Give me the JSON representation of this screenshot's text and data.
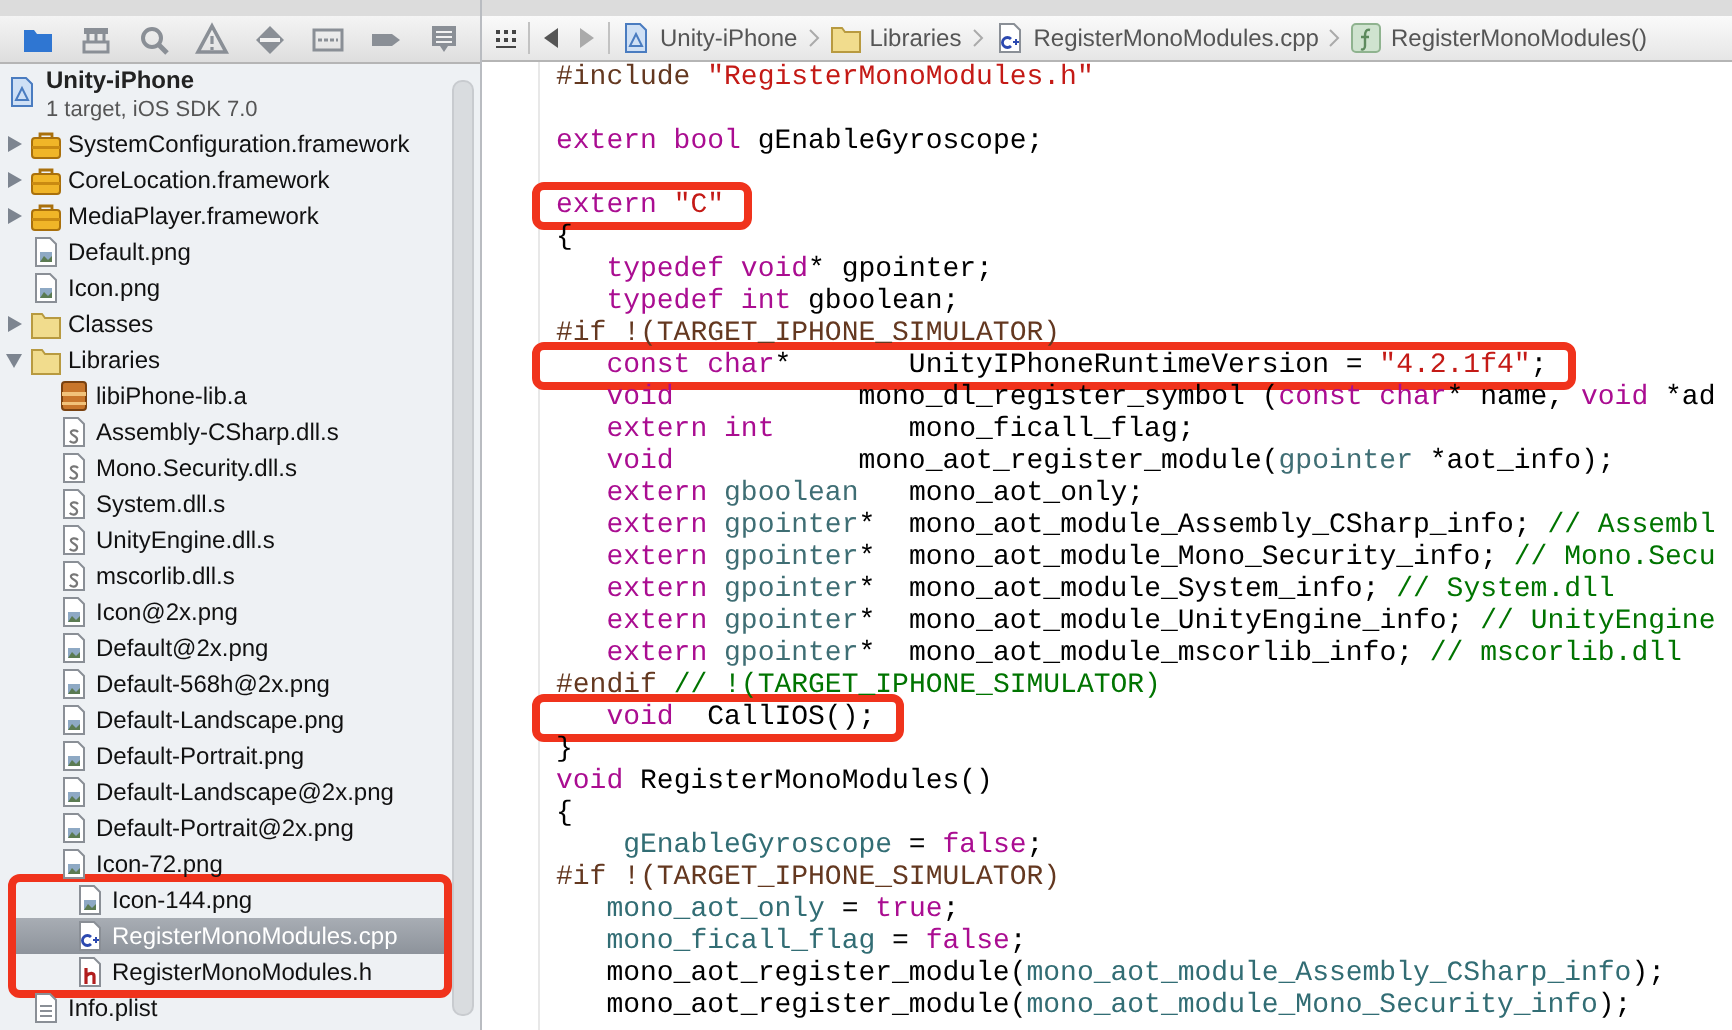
{
  "navigator": {
    "toolbar": [
      {
        "kind": "project",
        "selected": true
      },
      {
        "kind": "symbols",
        "selected": false
      },
      {
        "kind": "search",
        "selected": false
      },
      {
        "kind": "issues",
        "selected": false
      },
      {
        "kind": "tests",
        "selected": false
      },
      {
        "kind": "debug",
        "selected": false
      },
      {
        "kind": "breakpoints",
        "selected": false
      },
      {
        "kind": "log",
        "selected": false
      }
    ],
    "project": {
      "name": "Unity-iPhone",
      "subtitle": "1 target, iOS SDK 7.0"
    },
    "items": [
      {
        "label": "SystemConfiguration.framework",
        "kind": "framework",
        "expanded": false,
        "selected": false,
        "highlighted": false
      },
      {
        "label": "CoreLocation.framework",
        "kind": "framework",
        "expanded": false,
        "selected": false,
        "highlighted": false
      },
      {
        "label": "MediaPlayer.framework",
        "kind": "framework",
        "expanded": false,
        "selected": false,
        "highlighted": false
      },
      {
        "label": "Default.png",
        "kind": "image",
        "selected": false,
        "highlighted": false
      },
      {
        "label": "Icon.png",
        "kind": "image",
        "selected": false,
        "highlighted": false
      },
      {
        "label": "Classes",
        "kind": "folder",
        "expanded": false,
        "selected": false,
        "highlighted": false
      },
      {
        "label": "Libraries",
        "kind": "folder",
        "expanded": true,
        "selected": false,
        "highlighted": false,
        "children": [
          {
            "label": "libiPhone-lib.a",
            "kind": "library",
            "selected": false,
            "highlighted": false
          },
          {
            "label": "Assembly-CSharp.dll.s",
            "kind": "assembly",
            "selected": false,
            "highlighted": false
          },
          {
            "label": "Mono.Security.dll.s",
            "kind": "assembly",
            "selected": false,
            "highlighted": false
          },
          {
            "label": "System.dll.s",
            "kind": "assembly",
            "selected": false,
            "highlighted": false
          },
          {
            "label": "UnityEngine.dll.s",
            "kind": "assembly",
            "selected": false,
            "highlighted": false
          },
          {
            "label": "mscorlib.dll.s",
            "kind": "assembly",
            "selected": false,
            "highlighted": false
          },
          {
            "label": "Icon@2x.png",
            "kind": "image",
            "selected": false,
            "highlighted": false
          },
          {
            "label": "Default@2x.png",
            "kind": "image",
            "selected": false,
            "highlighted": false
          },
          {
            "label": "Default-568h@2x.png",
            "kind": "image",
            "selected": false,
            "highlighted": false
          },
          {
            "label": "Default-Landscape.png",
            "kind": "image",
            "selected": false,
            "highlighted": false
          },
          {
            "label": "Default-Portrait.png",
            "kind": "image",
            "selected": false,
            "highlighted": false
          },
          {
            "label": "Default-Landscape@2x.png",
            "kind": "image",
            "selected": false,
            "highlighted": false
          },
          {
            "label": "Default-Portrait@2x.png",
            "kind": "image",
            "selected": false,
            "highlighted": false
          },
          {
            "label": "Icon-72.png",
            "kind": "image",
            "selected": false,
            "highlighted": false
          },
          {
            "label": "Icon-144.png",
            "kind": "image",
            "selected": false,
            "highlighted": true
          },
          {
            "label": "RegisterMonoModules.cpp",
            "kind": "cpp",
            "selected": true,
            "highlighted": true
          },
          {
            "label": "RegisterMonoModules.h",
            "kind": "header",
            "selected": false,
            "highlighted": true
          }
        ]
      },
      {
        "label": "Info.plist",
        "kind": "plist",
        "selected": false,
        "highlighted": false
      }
    ]
  },
  "jump_bar": [
    {
      "label": "Unity-iPhone",
      "kind": "project"
    },
    {
      "label": "Libraries",
      "kind": "folder"
    },
    {
      "label": "RegisterMonoModules.cpp",
      "kind": "cpp"
    },
    {
      "label": "RegisterMonoModules()",
      "kind": "function"
    }
  ],
  "code": {
    "lines": [
      {
        "kind": "code",
        "highlighted": false,
        "tokens": [
          {
            "kind": "preproc",
            "text": "#include "
          },
          {
            "kind": "string",
            "text": "\"RegisterMonoModules.h\""
          }
        ]
      },
      {
        "kind": "blank"
      },
      {
        "kind": "code",
        "highlighted": false,
        "tokens": [
          {
            "kind": "keyword",
            "text": "extern bool"
          },
          {
            "kind": "plain",
            "text": " gEnableGyroscope;"
          }
        ]
      },
      {
        "kind": "blank"
      },
      {
        "kind": "code",
        "highlighted": true,
        "tokens": [
          {
            "kind": "keyword",
            "text": "extern "
          },
          {
            "kind": "string",
            "text": "\"C\""
          }
        ]
      },
      {
        "kind": "code",
        "highlighted": false,
        "tokens": [
          {
            "kind": "plain",
            "text": "{"
          }
        ]
      },
      {
        "kind": "code",
        "highlighted": false,
        "tokens": [
          {
            "kind": "keyword",
            "text": "   typedef void"
          },
          {
            "kind": "plain",
            "text": "* gpointer;"
          }
        ]
      },
      {
        "kind": "code",
        "highlighted": false,
        "tokens": [
          {
            "kind": "keyword",
            "text": "   typedef int"
          },
          {
            "kind": "plain",
            "text": " gboolean;"
          }
        ]
      },
      {
        "kind": "code",
        "highlighted": false,
        "tokens": [
          {
            "kind": "preproc",
            "text": "#if !(TARGET_IPHONE_SIMULATOR)"
          }
        ]
      },
      {
        "kind": "code",
        "highlighted": true,
        "tokens": [
          {
            "kind": "keyword",
            "text": "   const char"
          },
          {
            "kind": "plain",
            "text": "*       UnityIPhoneRuntimeVersion = "
          },
          {
            "kind": "string",
            "text": "\"4.2.1f4\""
          },
          {
            "kind": "plain",
            "text": ";"
          }
        ]
      },
      {
        "kind": "code",
        "highlighted": false,
        "tokens": [
          {
            "kind": "keyword",
            "text": "   void"
          },
          {
            "kind": "plain",
            "text": "           mono_dl_register_symbol ("
          },
          {
            "kind": "keyword",
            "text": "const char"
          },
          {
            "kind": "plain",
            "text": "* name, "
          },
          {
            "kind": "keyword",
            "text": "void"
          },
          {
            "kind": "plain",
            "text": " *ad"
          }
        ]
      },
      {
        "kind": "code",
        "highlighted": false,
        "tokens": [
          {
            "kind": "keyword",
            "text": "   extern int"
          },
          {
            "kind": "plain",
            "text": "        mono_ficall_flag;"
          }
        ]
      },
      {
        "kind": "code",
        "highlighted": false,
        "tokens": [
          {
            "kind": "keyword",
            "text": "   void"
          },
          {
            "kind": "plain",
            "text": "           mono_aot_register_module("
          },
          {
            "kind": "type",
            "text": "gpointer"
          },
          {
            "kind": "plain",
            "text": " *aot_info);"
          }
        ]
      },
      {
        "kind": "code",
        "highlighted": false,
        "tokens": [
          {
            "kind": "keyword",
            "text": "   extern"
          },
          {
            "kind": "type",
            "text": " gboolean"
          },
          {
            "kind": "plain",
            "text": "   mono_aot_only;"
          }
        ]
      },
      {
        "kind": "code",
        "highlighted": false,
        "tokens": [
          {
            "kind": "keyword",
            "text": "   extern"
          },
          {
            "kind": "type",
            "text": " gpointer"
          },
          {
            "kind": "plain",
            "text": "*  mono_aot_module_Assembly_CSharp_info; "
          },
          {
            "kind": "comment",
            "text": "// Assembl"
          }
        ]
      },
      {
        "kind": "code",
        "highlighted": false,
        "tokens": [
          {
            "kind": "keyword",
            "text": "   extern"
          },
          {
            "kind": "type",
            "text": " gpointer"
          },
          {
            "kind": "plain",
            "text": "*  mono_aot_module_Mono_Security_info; "
          },
          {
            "kind": "comment",
            "text": "// Mono.Secu"
          }
        ]
      },
      {
        "kind": "code",
        "highlighted": false,
        "tokens": [
          {
            "kind": "keyword",
            "text": "   extern"
          },
          {
            "kind": "type",
            "text": " gpointer"
          },
          {
            "kind": "plain",
            "text": "*  mono_aot_module_System_info; "
          },
          {
            "kind": "comment",
            "text": "// System.dll"
          }
        ]
      },
      {
        "kind": "code",
        "highlighted": false,
        "tokens": [
          {
            "kind": "keyword",
            "text": "   extern"
          },
          {
            "kind": "type",
            "text": " gpointer"
          },
          {
            "kind": "plain",
            "text": "*  mono_aot_module_UnityEngine_info; "
          },
          {
            "kind": "comment",
            "text": "// UnityEngine"
          }
        ]
      },
      {
        "kind": "code",
        "highlighted": false,
        "tokens": [
          {
            "kind": "keyword",
            "text": "   extern"
          },
          {
            "kind": "type",
            "text": " gpointer"
          },
          {
            "kind": "plain",
            "text": "*  mono_aot_module_mscorlib_info; "
          },
          {
            "kind": "comment",
            "text": "// mscorlib.dll"
          }
        ]
      },
      {
        "kind": "code",
        "highlighted": false,
        "tokens": [
          {
            "kind": "preproc",
            "text": "#endif"
          },
          {
            "kind": "comment",
            "text": " // !(TARGET_IPHONE_SIMULATOR)"
          }
        ]
      },
      {
        "kind": "code",
        "highlighted": true,
        "tokens": [
          {
            "kind": "keyword",
            "text": "   void"
          },
          {
            "kind": "plain",
            "text": "  CallIOS();"
          }
        ]
      },
      {
        "kind": "code",
        "highlighted": false,
        "tokens": [
          {
            "kind": "plain",
            "text": "}"
          }
        ]
      },
      {
        "kind": "code",
        "highlighted": false,
        "tokens": [
          {
            "kind": "keyword",
            "text": "void"
          },
          {
            "kind": "plain",
            "text": " RegisterMonoModules()"
          }
        ]
      },
      {
        "kind": "code",
        "highlighted": false,
        "tokens": [
          {
            "kind": "plain",
            "text": "{"
          }
        ]
      },
      {
        "kind": "code",
        "highlighted": false,
        "tokens": [
          {
            "kind": "ident",
            "text": "    gEnableGyroscope"
          },
          {
            "kind": "plain",
            "text": " = "
          },
          {
            "kind": "keyword",
            "text": "false"
          },
          {
            "kind": "plain",
            "text": ";"
          }
        ]
      },
      {
        "kind": "code",
        "highlighted": false,
        "tokens": [
          {
            "kind": "preproc",
            "text": "#if !(TARGET_IPHONE_SIMULATOR)"
          }
        ]
      },
      {
        "kind": "code",
        "highlighted": false,
        "tokens": [
          {
            "kind": "ident",
            "text": "   mono_aot_only"
          },
          {
            "kind": "plain",
            "text": " = "
          },
          {
            "kind": "keyword",
            "text": "true"
          },
          {
            "kind": "plain",
            "text": ";"
          }
        ]
      },
      {
        "kind": "code",
        "highlighted": false,
        "tokens": [
          {
            "kind": "ident",
            "text": "   mono_ficall_flag"
          },
          {
            "kind": "plain",
            "text": " = "
          },
          {
            "kind": "keyword",
            "text": "false"
          },
          {
            "kind": "plain",
            "text": ";"
          }
        ]
      },
      {
        "kind": "code",
        "highlighted": false,
        "tokens": [
          {
            "kind": "plain",
            "text": "   mono_aot_register_module("
          },
          {
            "kind": "ident",
            "text": "mono_aot_module_Assembly_CSharp_info"
          },
          {
            "kind": "plain",
            "text": ");"
          }
        ]
      },
      {
        "kind": "code",
        "highlighted": false,
        "tokens": [
          {
            "kind": "plain",
            "text": "   mono_aot_register_module("
          },
          {
            "kind": "ident",
            "text": "mono_aot_module_Mono_Security_info"
          },
          {
            "kind": "plain",
            "text": ");"
          }
        ]
      }
    ]
  }
}
